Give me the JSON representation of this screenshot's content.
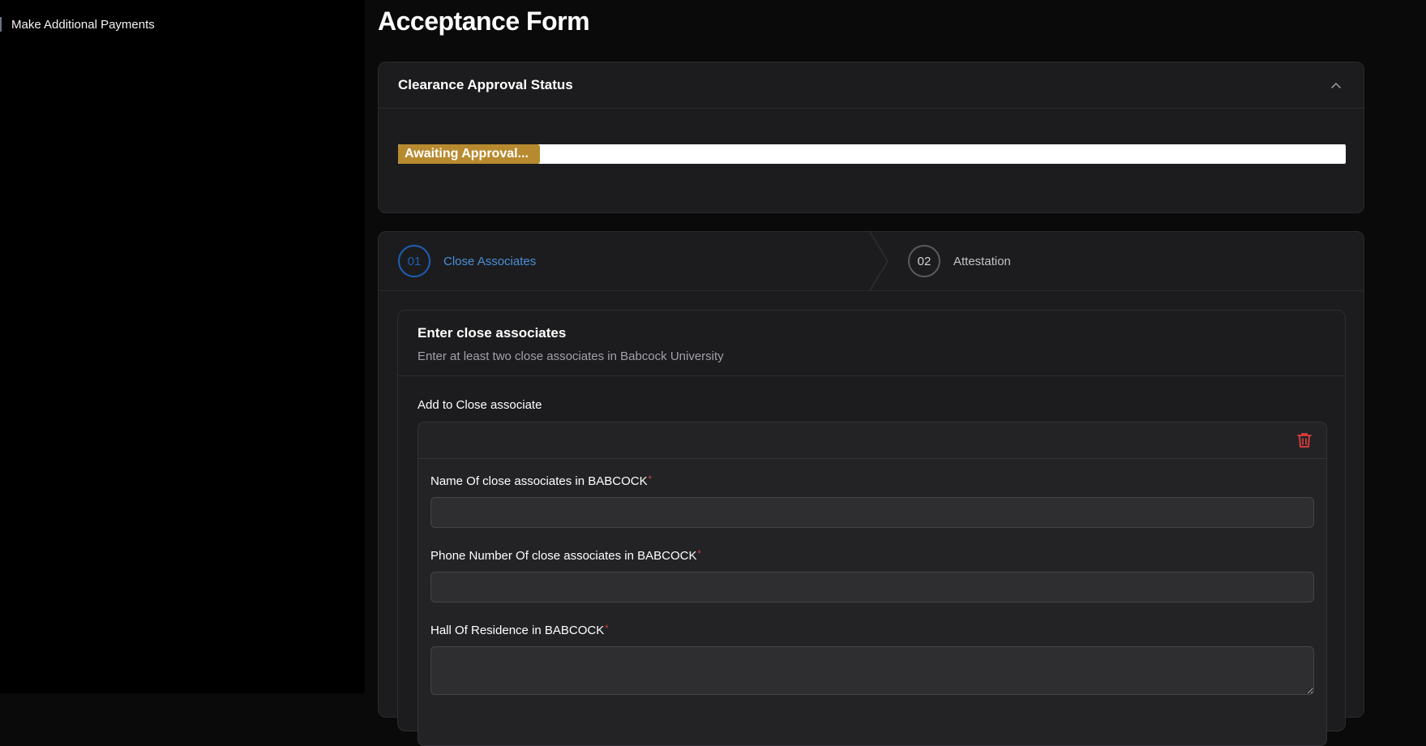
{
  "sidebar": {
    "items": [
      {
        "label": "Make Additional Payments"
      }
    ]
  },
  "page": {
    "title": "Acceptance Form"
  },
  "status_card": {
    "title": "Clearance Approval Status",
    "progress_label": "Awaiting Approval...",
    "progress_fraction": 0.15,
    "progress_color": "#b88a2f",
    "icon": "chevron-up-icon"
  },
  "stepper": {
    "steps": [
      {
        "number": "01",
        "label": "Close Associates",
        "state": "active"
      },
      {
        "number": "02",
        "label": "Attestation",
        "state": "inactive"
      }
    ]
  },
  "associates": {
    "title": "Enter close associates",
    "subtitle": "Enter at least two close associates in Babcock University",
    "section_label": "Add to Close associate",
    "delete_icon": "trash-icon",
    "fields": {
      "name_label": "Name Of close associates in BABCOCK",
      "name_value": "",
      "phone_label": "Phone Number Of close associates in BABCOCK",
      "phone_value": "",
      "hall_label": "Hall Of Residence in BABCOCK",
      "hall_value": "",
      "required_marker": "*"
    }
  },
  "colors": {
    "background": "#0a0a0b",
    "card": "#1c1c1e",
    "accent_blue": "#1d5fb8",
    "danger": "#e53e3e",
    "warning": "#b88a2f"
  }
}
